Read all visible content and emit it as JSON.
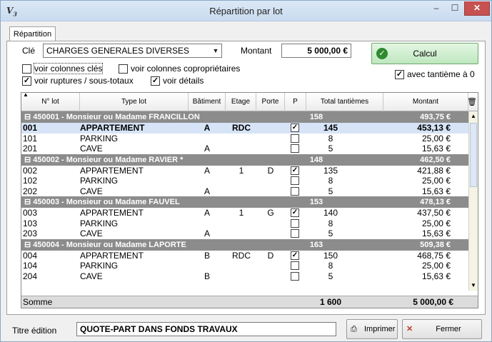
{
  "window": {
    "title": "Répartition par lot",
    "icon_name": "app-v3-icon",
    "icon_text": "V",
    "icon_sub": "3"
  },
  "tab": {
    "label": "Répartition"
  },
  "form": {
    "cle_label": "Clé",
    "cle_value": "CHARGES GENERALES DIVERSES",
    "montant_label": "Montant",
    "montant_value": "5 000,00 €",
    "calcul_label": "Calcul",
    "options": {
      "voir_colonnes_cles": {
        "label": "voir colonnes clés",
        "checked": false
      },
      "voir_colonnes_coproprietaires": {
        "label": "voir colonnes copropriétaires",
        "checked": false
      },
      "voir_ruptures": {
        "label": "voir ruptures / sous-totaux",
        "checked": true
      },
      "voir_details": {
        "label": "voir détails",
        "checked": true
      },
      "avec_tantieme": {
        "label": "avec tantième à 0",
        "checked": true
      }
    }
  },
  "grid": {
    "headers": {
      "lot": "N° lot",
      "type": "Type lot",
      "batiment": "Bâtiment",
      "etage": "Etage",
      "porte": "Porte",
      "p": "P",
      "tantiemes": "Total tantièmes",
      "montant": "Montant"
    },
    "groups": [
      {
        "name": "450001 - Monsieur ou Madame FRANCILLON",
        "tantiemes": "158",
        "montant": "493,75 €",
        "rows": [
          {
            "lot": "001",
            "type": "APPARTEMENT",
            "batiment": "A",
            "etage": "RDC",
            "porte": "",
            "p": "✓",
            "tantiemes": "145",
            "montant": "453,13 €",
            "selected": true
          },
          {
            "lot": "101",
            "type": "PARKING",
            "batiment": "",
            "etage": "",
            "porte": "",
            "p": "",
            "tantiemes": "8",
            "montant": "25,00 €"
          },
          {
            "lot": "201",
            "type": "CAVE",
            "batiment": "A",
            "etage": "",
            "porte": "",
            "p": "",
            "tantiemes": "5",
            "montant": "15,63 €"
          }
        ]
      },
      {
        "name": "450002 - Monsieur ou Madame RAVIER *",
        "tantiemes": "148",
        "montant": "462,50 €",
        "rows": [
          {
            "lot": "002",
            "type": "APPARTEMENT",
            "batiment": "A",
            "etage": "1",
            "porte": "D",
            "p": "✓",
            "tantiemes": "135",
            "montant": "421,88 €"
          },
          {
            "lot": "102",
            "type": "PARKING",
            "batiment": "",
            "etage": "",
            "porte": "",
            "p": "",
            "tantiemes": "8",
            "montant": "25,00 €"
          },
          {
            "lot": "202",
            "type": "CAVE",
            "batiment": "A",
            "etage": "",
            "porte": "",
            "p": "",
            "tantiemes": "5",
            "montant": "15,63 €"
          }
        ]
      },
      {
        "name": "450003 - Monsieur ou Madame FAUVEL",
        "tantiemes": "153",
        "montant": "478,13 €",
        "rows": [
          {
            "lot": "003",
            "type": "APPARTEMENT",
            "batiment": "A",
            "etage": "1",
            "porte": "G",
            "p": "✓",
            "tantiemes": "140",
            "montant": "437,50 €"
          },
          {
            "lot": "103",
            "type": "PARKING",
            "batiment": "",
            "etage": "",
            "porte": "",
            "p": "",
            "tantiemes": "8",
            "montant": "25,00 €"
          },
          {
            "lot": "203",
            "type": "CAVE",
            "batiment": "A",
            "etage": "",
            "porte": "",
            "p": "",
            "tantiemes": "5",
            "montant": "15,63 €"
          }
        ]
      },
      {
        "name": "450004 - Monsieur ou Madame LAPORTE",
        "tantiemes": "163",
        "montant": "509,38 €",
        "rows": [
          {
            "lot": "004",
            "type": "APPARTEMENT",
            "batiment": "B",
            "etage": "RDC",
            "porte": "D",
            "p": "✓",
            "tantiemes": "150",
            "montant": "468,75 €"
          },
          {
            "lot": "104",
            "type": "PARKING",
            "batiment": "",
            "etage": "",
            "porte": "",
            "p": "",
            "tantiemes": "8",
            "montant": "25,00 €"
          },
          {
            "lot": "204",
            "type": "CAVE",
            "batiment": "B",
            "etage": "",
            "porte": "",
            "p": "",
            "tantiemes": "5",
            "montant": "15,63 €"
          }
        ]
      }
    ],
    "total": {
      "label": "Somme",
      "tantiemes": "1 600",
      "montant": "5 000,00 €"
    }
  },
  "footer": {
    "titre_label": "Titre édition",
    "titre_value": "QUOTE-PART DANS FONDS TRAVAUX",
    "print_label": "Imprimer",
    "close_label": "Fermer"
  },
  "colors": {
    "group_bg": "#8c8c8c",
    "selected_row": "#d7e4f7",
    "calcul_green": "#2e8b2e",
    "close_red": "#c0392b"
  }
}
